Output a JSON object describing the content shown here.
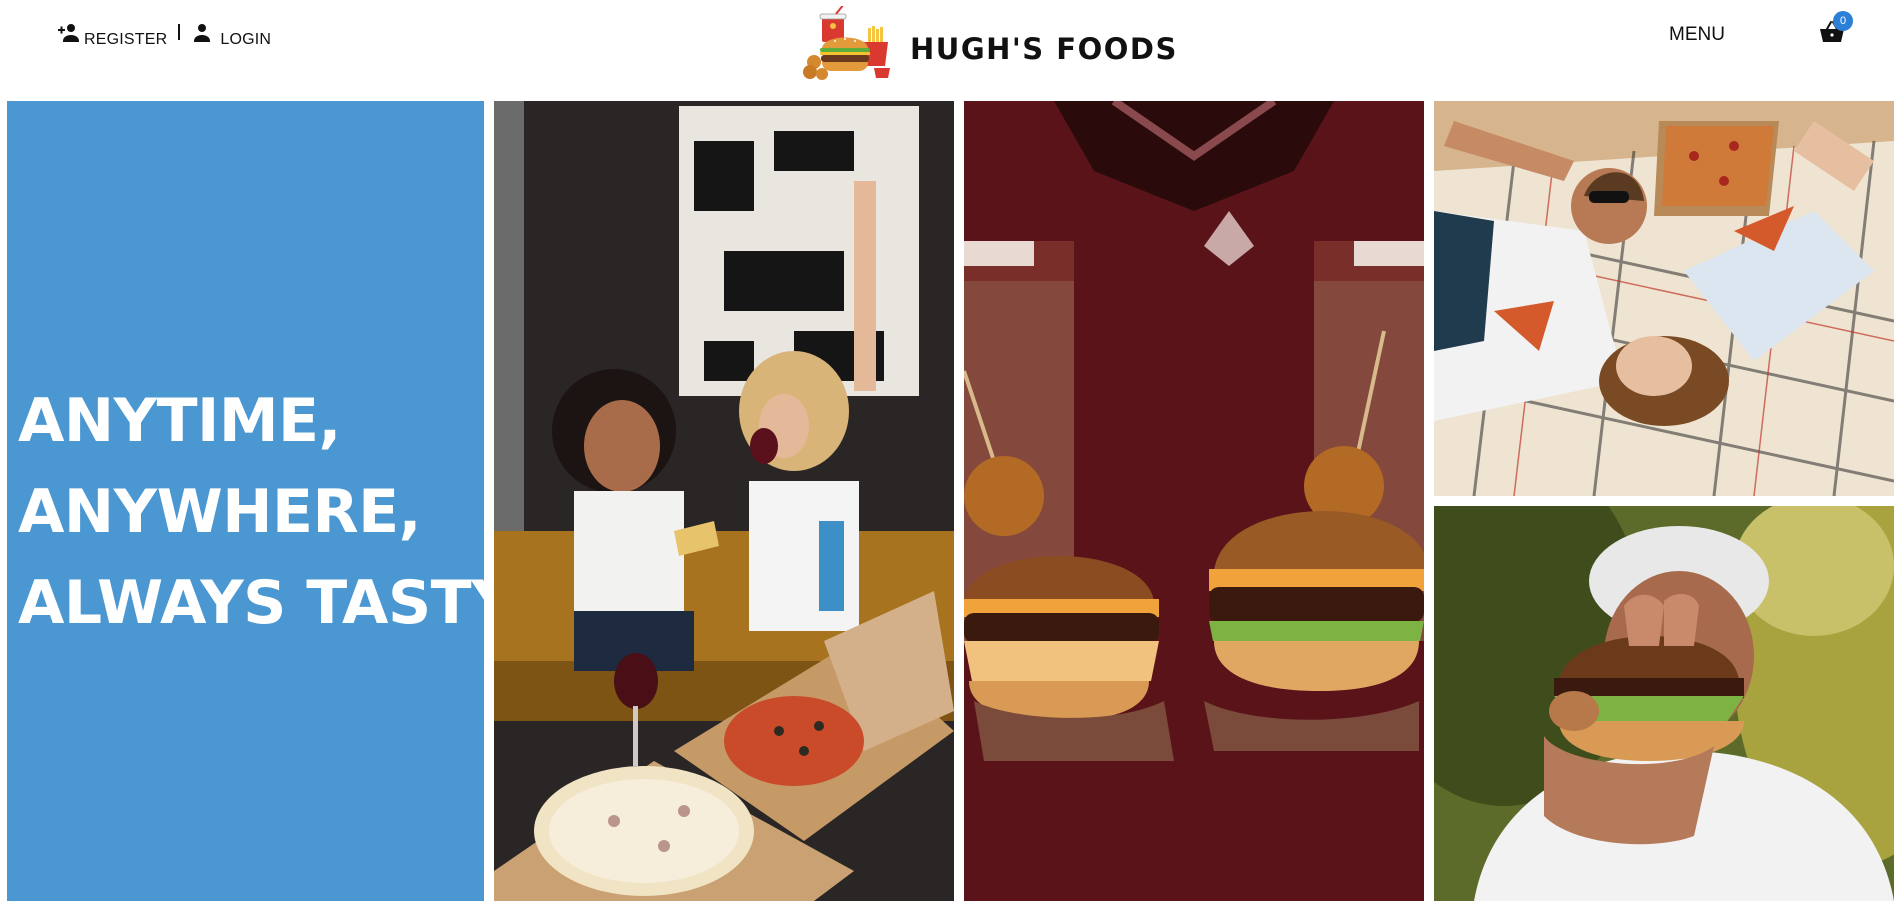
{
  "header": {
    "register_label": "REGISTER",
    "login_label": "LOGIN",
    "brand_name": "HUGH'S FOODS",
    "menu_label": "MENU",
    "cart_count": "0"
  },
  "hero": {
    "line1": "ANYTIME,",
    "line2": "ANYWHERE,",
    "line3": "ALWAYS TASTY"
  },
  "icons": {
    "register": "person-add-icon",
    "login": "person-icon",
    "cart": "shopping-basket-icon",
    "logo": "fast-food-logo"
  },
  "colors": {
    "hero_panel": "#4a97d2",
    "cart_badge": "#2b7fd6",
    "text": "#111111"
  }
}
